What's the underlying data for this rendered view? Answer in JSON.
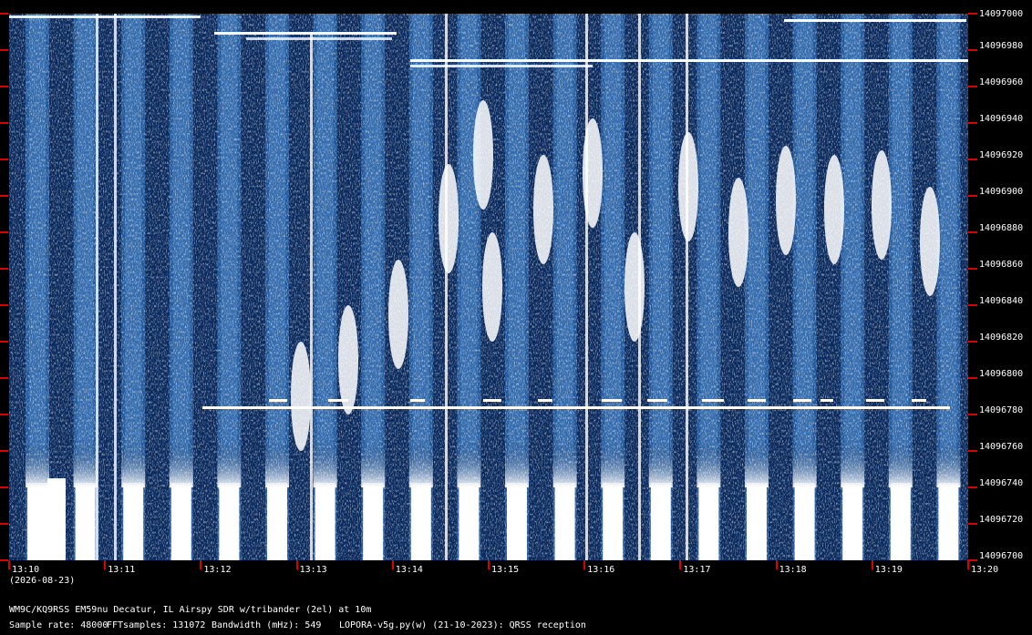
{
  "time_axis": {
    "labels": [
      "13:10",
      "13:11",
      "13:12",
      "13:13",
      "13:14",
      "13:15",
      "13:16",
      "13:17",
      "13:18",
      "13:19",
      "13:20"
    ],
    "date": "(2026-08-23)"
  },
  "freq_axis": {
    "labels": [
      "14097000",
      "14096980",
      "14096960",
      "14096940",
      "14096920",
      "14096900",
      "14096880",
      "14096860",
      "14096840",
      "14096820",
      "14096800",
      "14096780",
      "14096760",
      "14096740",
      "14096720",
      "14096700"
    ]
  },
  "footer": {
    "station": "WM9C/KQ9RSS EM59nu Decatur, IL  Airspy SDR w/tribander (2el) at 10m",
    "sample_rate": "Sample rate: 48000",
    "fft_samples": "FFTsamples: 131072",
    "bandwidth": "Bandwidth (mHz): 549",
    "software": "LOPORA-v5g.py(w) (21-10-2023): QRSS reception"
  },
  "colors": {
    "background": "#000000",
    "waterfall_dark": "#0a2a5e",
    "waterfall_mid": "#1f5aa0",
    "signal": "#ffffff",
    "tick": "#dd0000"
  }
}
